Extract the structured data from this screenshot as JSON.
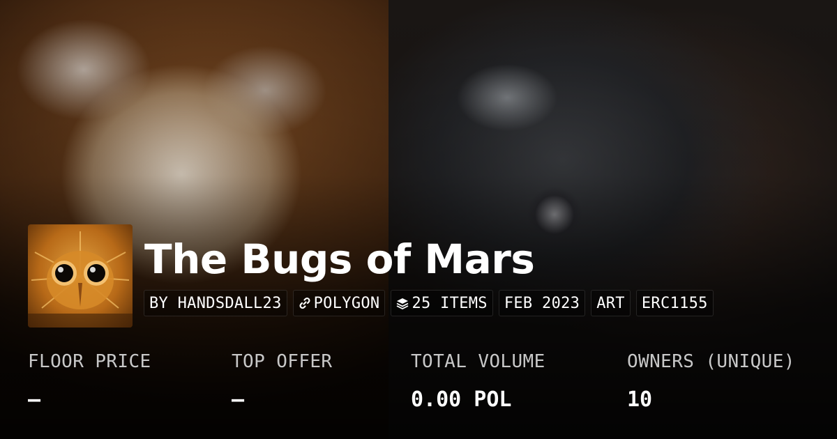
{
  "collection": {
    "title": "The Bugs of Mars"
  },
  "tags": [
    {
      "label": "BY HANDSDALL23",
      "icon": ""
    },
    {
      "label": "POLYGON",
      "icon": "link-icon"
    },
    {
      "label": "25 ITEMS",
      "icon": "layers-icon"
    },
    {
      "label": "FEB 2023",
      "icon": ""
    },
    {
      "label": "ART",
      "icon": ""
    },
    {
      "label": "ERC1155",
      "icon": ""
    }
  ],
  "stats": [
    {
      "label": "FLOOR PRICE",
      "value": "–"
    },
    {
      "label": "TOP OFFER",
      "value": "–"
    },
    {
      "label": "TOTAL VOLUME",
      "value": "0.00 POL"
    },
    {
      "label": "OWNERS (UNIQUE)",
      "value": "10"
    }
  ],
  "colors": {
    "text": "#ffffff",
    "label": "#c8c8c8",
    "tag_background": "rgba(0,0,0,0.35)"
  }
}
